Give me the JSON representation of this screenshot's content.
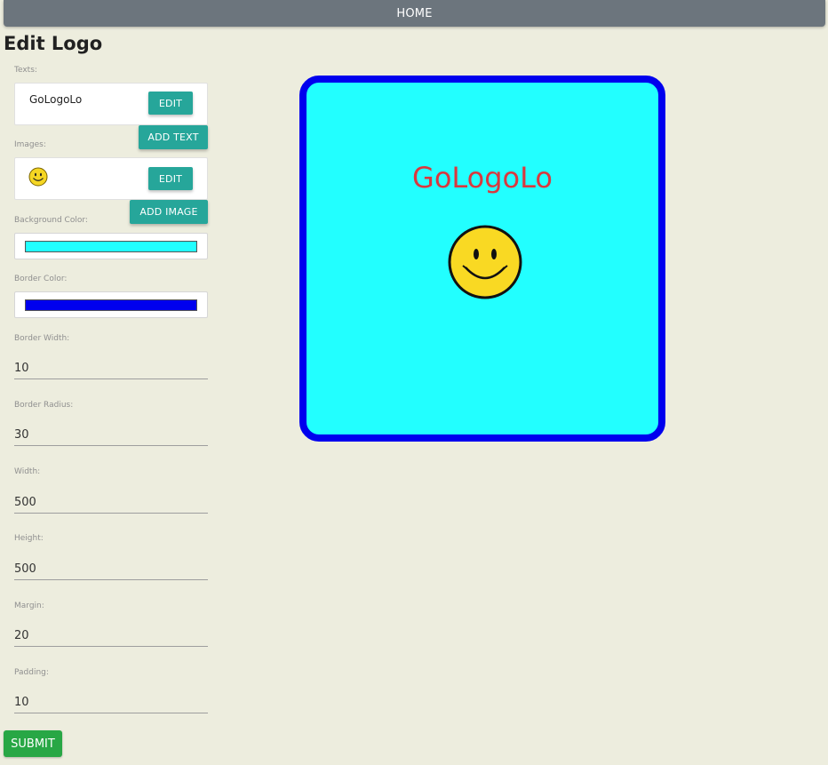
{
  "nav": {
    "home_label": "HOME"
  },
  "page_title": "Edit Logo",
  "texts": {
    "label": "Texts:",
    "items": [
      {
        "text": "GoLogoLo",
        "edit_label": "EDIT"
      }
    ],
    "add_label": "ADD TEXT"
  },
  "images": {
    "label": "Images:",
    "items": [
      {
        "icon": "smiley-icon",
        "edit_label": "EDIT"
      }
    ],
    "add_label": "ADD IMAGE"
  },
  "background_color": {
    "label": "Background Color:",
    "value": "#22ffff"
  },
  "border_color": {
    "label": "Border Color:",
    "value": "#0000ee"
  },
  "border_width": {
    "label": "Border Width:",
    "value": "10"
  },
  "border_radius": {
    "label": "Border Radius:",
    "value": "30"
  },
  "width": {
    "label": "Width:",
    "value": "500"
  },
  "height": {
    "label": "Height:",
    "value": "500"
  },
  "margin": {
    "label": "Margin:",
    "value": "20"
  },
  "padding": {
    "label": "Padding:",
    "value": "10"
  },
  "submit_label": "SUBMIT",
  "logo": {
    "text": "GoLogoLo",
    "text_color": "#d9383e",
    "background_color": "#22ffff",
    "border_color": "#0000ee",
    "image_icon": "smiley-icon"
  }
}
